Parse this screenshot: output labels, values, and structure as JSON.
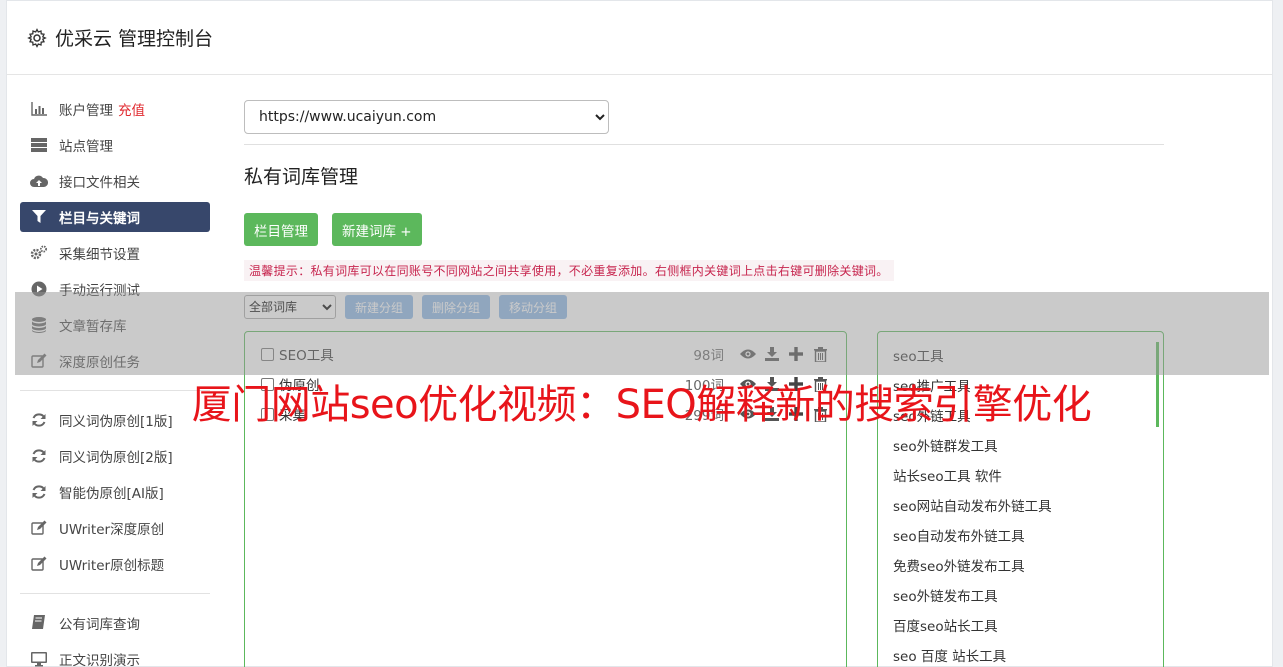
{
  "app": {
    "title": "优采云 管理控制台"
  },
  "sidebar": {
    "group1": [
      {
        "label": "账户管理",
        "extra": "充值",
        "icon": "bar-chart-icon"
      },
      {
        "label": "站点管理",
        "icon": "server-icon"
      },
      {
        "label": "接口文件相关",
        "icon": "cloud-upload-icon"
      },
      {
        "label": "栏目与关键词",
        "icon": "filter-icon",
        "active": true
      },
      {
        "label": "采集细节设置",
        "icon": "cogs-icon"
      },
      {
        "label": "手动运行测试",
        "icon": "play-circle-icon"
      },
      {
        "label": "文章暂存库",
        "icon": "database-icon"
      },
      {
        "label": "深度原创任务",
        "icon": "edit-icon"
      }
    ],
    "group2": [
      {
        "label": "同义词伪原创[1版]",
        "icon": "refresh-icon"
      },
      {
        "label": "同义词伪原创[2版]",
        "icon": "refresh-icon"
      },
      {
        "label": "智能伪原创[AI版]",
        "icon": "refresh-icon"
      },
      {
        "label": "UWriter深度原创",
        "icon": "edit-icon"
      },
      {
        "label": "UWriter原创标题",
        "icon": "edit-icon"
      }
    ],
    "group3": [
      {
        "label": "公有词库查询",
        "icon": "book-icon"
      },
      {
        "label": "正文识别演示",
        "icon": "monitor-icon"
      }
    ]
  },
  "main": {
    "site_url": "https://www.ucaiyun.com",
    "section_title": "私有词库管理",
    "btn_columns": "栏目管理",
    "btn_new_lib": "新建词库 +",
    "tip": "温馨提示：私有词库可以在同账号不同网站之间共享使用，不必重复添加。右侧框内关键词上点击右键可删除关键词。",
    "group_select": "全部词库",
    "btn_new_group": "新建分组",
    "btn_delete_group": "删除分组",
    "btn_move_group": "移动分组"
  },
  "libraries": [
    {
      "name": "SEO工具",
      "count": "98词"
    },
    {
      "name": "伪原创",
      "count": "100词"
    },
    {
      "name": "采集",
      "count": "299词"
    }
  ],
  "keywords": [
    "seo工具",
    "seo推广工具",
    "seo外链工具",
    "seo外链群发工具",
    "站长seo工具 软件",
    "seo网站自动发布外链工具",
    "seo自动发布外链工具",
    "免费seo外链发布工具",
    "seo外链发布工具",
    "百度seo站长工具",
    "seo 百度 站长工具"
  ],
  "overlay": {
    "headline": "厦门网站seo优化视频：SEO解释新的搜索引擎优化"
  },
  "colors": {
    "accent_green": "#5cb85c",
    "nav_active": "#37476b",
    "headline_red": "#e8141a",
    "recharge_red": "#e0292f"
  }
}
